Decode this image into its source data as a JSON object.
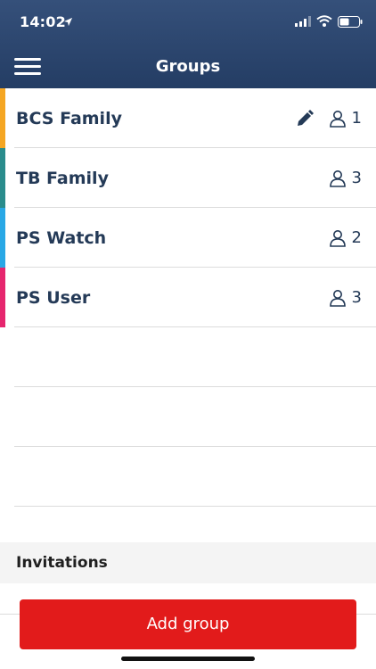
{
  "status_bar": {
    "time": "14:02"
  },
  "header": {
    "title": "Groups"
  },
  "groups": [
    {
      "name": "BCS Family",
      "count": "1",
      "color": "#f5a623",
      "editable": true
    },
    {
      "name": "TB Family",
      "count": "3",
      "color": "#2a8c8c",
      "editable": false
    },
    {
      "name": "PS Watch",
      "count": "2",
      "color": "#29a8e6",
      "editable": false
    },
    {
      "name": "PS User",
      "count": "3",
      "color": "#e6266e",
      "editable": false
    }
  ],
  "invitations": {
    "label": "Invitations"
  },
  "add_button": {
    "label": "Add group"
  },
  "icons": [
    "location-arrow-icon",
    "signal-icon",
    "wifi-icon",
    "battery-icon",
    "menu-icon",
    "pencil-icon",
    "person-icon"
  ]
}
